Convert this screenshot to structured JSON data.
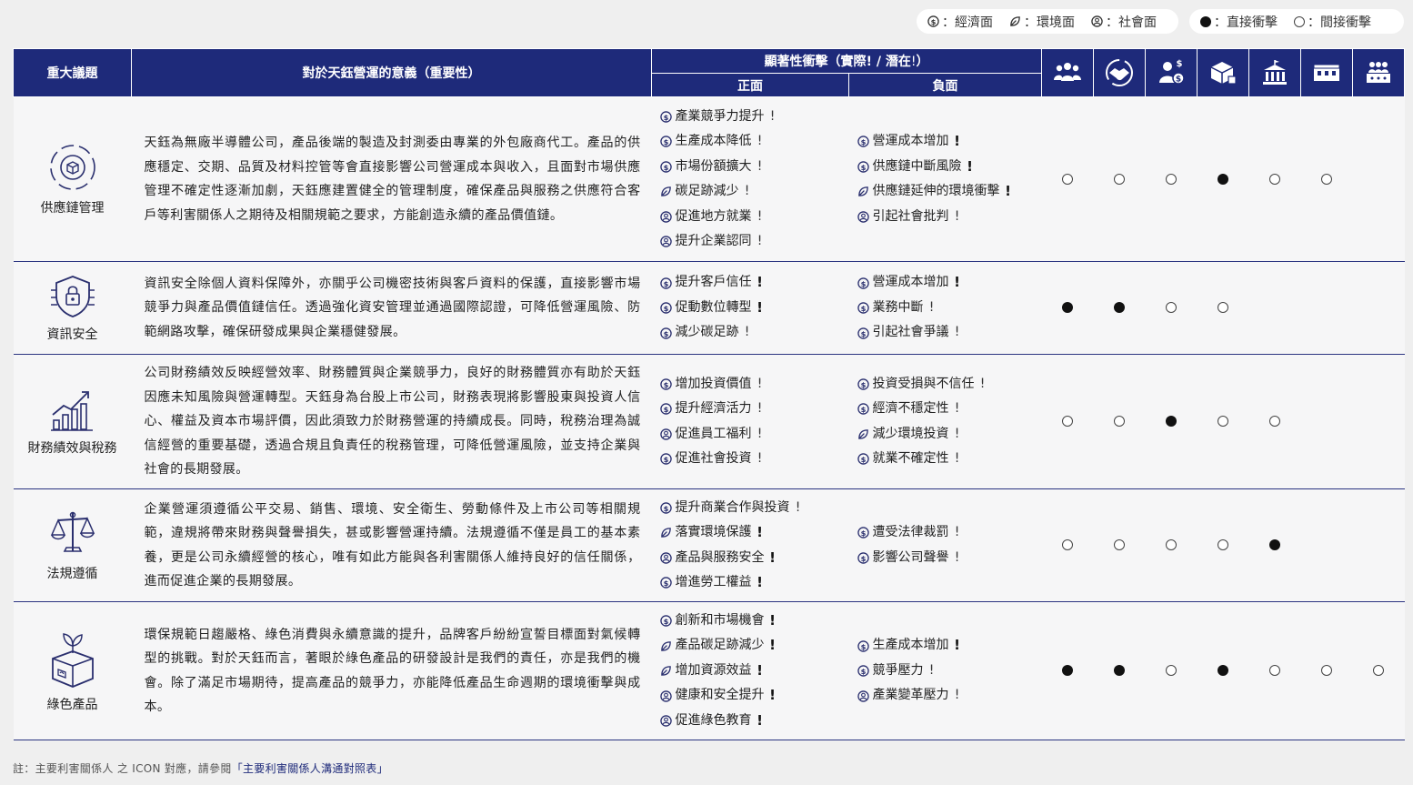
{
  "legend": {
    "dimensions": [
      {
        "icon": "economic-icon",
        "label": "：經濟面"
      },
      {
        "icon": "environment-icon",
        "label": "：環境面"
      },
      {
        "icon": "social-icon",
        "label": "：社會面"
      }
    ],
    "impacts": [
      {
        "type": "filled",
        "label": "：直接衝擊"
      },
      {
        "type": "empty",
        "label": "：間接衝擊"
      }
    ]
  },
  "header": {
    "topic": "重大議題",
    "meaning": "對於天鈺營運的意義（重要性）",
    "impact_title_pre": "顯著性衝擊（實際",
    "impact_title_mid": " / 潛在",
    "impact_title_post": "）",
    "positive": "正面",
    "negative": "負面",
    "stakeholder_icons": [
      "employees-icon",
      "customers-icon",
      "investors-icon",
      "suppliers-icon",
      "government-icon",
      "community-icon",
      "media-icon"
    ]
  },
  "rows": [
    {
      "topic": "供應鏈管理",
      "icon": "supply-chain-icon",
      "description": "天鈺為無廠半導體公司，產品後端的製造及封測委由專業的外包廠商代工。產品的供應穩定、交期、品質及材料控管等會直接影響公司營運成本與收入，且面對市場供應管理不確定性逐漸加劇，天鈺應建置健全的管理制度，確保產品與服務之供應符合客戶等利害關係人之期待及相關規範之要求，方能創造永續的產品價值鏈。",
      "positive": [
        {
          "dim": "economic",
          "text": "產業競爭力提升",
          "kind": "potential"
        },
        {
          "dim": "economic",
          "text": "生產成本降低",
          "kind": "potential"
        },
        {
          "dim": "economic",
          "text": "市場份額擴大",
          "kind": "potential"
        },
        {
          "dim": "environment",
          "text": "碳足跡減少",
          "kind": "potential"
        },
        {
          "dim": "social",
          "text": "促進地方就業",
          "kind": "potential"
        },
        {
          "dim": "social",
          "text": "提升企業認同",
          "kind": "potential"
        }
      ],
      "negative": [
        {
          "dim": "economic",
          "text": "營運成本增加",
          "kind": "actual"
        },
        {
          "dim": "economic",
          "text": "供應鏈中斷風險",
          "kind": "actual"
        },
        {
          "dim": "environment",
          "text": "供應鏈延伸的環境衝擊",
          "kind": "actual"
        },
        {
          "dim": "social",
          "text": "引起社會批判",
          "kind": "potential"
        }
      ],
      "impacts": [
        "empty",
        "empty",
        "empty",
        "filled",
        "empty",
        "empty",
        ""
      ]
    },
    {
      "topic": "資訊安全",
      "icon": "info-security-icon",
      "description": "資訊安全除個人資料保障外，亦關乎公司機密技術與客戶資料的保護，直接影響市場競爭力與產品價值鏈信任。透過強化資安管理並通過國際認證，可降低營運風險、防範網路攻擊，確保研發成果與企業穩健發展。",
      "positive": [
        {
          "dim": "economic",
          "text": "提升客戶信任",
          "kind": "actual"
        },
        {
          "dim": "economic",
          "text": "促動數位轉型",
          "kind": "actual"
        },
        {
          "dim": "economic",
          "text": "減少碳足跡",
          "kind": "potential"
        }
      ],
      "negative": [
        {
          "dim": "economic",
          "text": "營運成本增加",
          "kind": "actual"
        },
        {
          "dim": "economic",
          "text": "業務中斷",
          "kind": "potential"
        },
        {
          "dim": "economic",
          "text": "引起社會爭議",
          "kind": "potential"
        }
      ],
      "impacts": [
        "filled",
        "filled",
        "empty",
        "empty",
        "",
        "",
        ""
      ]
    },
    {
      "topic": "財務績效與稅務",
      "icon": "finance-icon",
      "description": "公司財務績效反映經營效率、財務體質與企業競爭力，良好的財務體質亦有助於天鈺因應未知風險與營運轉型。天鈺身為台股上市公司，財務表現將影響股東與投資人信心、權益及資本市場評價，因此須致力於財務營運的持續成長。同時，稅務治理為誠信經營的重要基礎，透過合規且負責任的稅務管理，可降低營運風險，並支持企業與社會的長期發展。",
      "positive": [
        {
          "dim": "economic",
          "text": "增加投資價值",
          "kind": "potential"
        },
        {
          "dim": "economic",
          "text": "提升經濟活力",
          "kind": "potential"
        },
        {
          "dim": "social",
          "text": "促進員工福利",
          "kind": "potential"
        },
        {
          "dim": "economic",
          "text": "促進社會投資",
          "kind": "potential"
        }
      ],
      "negative": [
        {
          "dim": "economic",
          "text": "投資受損與不信任",
          "kind": "potential"
        },
        {
          "dim": "economic",
          "text": "經濟不穩定性",
          "kind": "potential"
        },
        {
          "dim": "environment",
          "text": "減少環境投資",
          "kind": "potential"
        },
        {
          "dim": "economic",
          "text": "就業不確定性",
          "kind": "potential"
        }
      ],
      "impacts": [
        "empty",
        "empty",
        "filled",
        "empty",
        "empty",
        "",
        ""
      ]
    },
    {
      "topic": "法規遵循",
      "icon": "compliance-icon",
      "description": "企業營運須遵循公平交易、銷售、環境、安全衛生、勞動條件及上市公司等相關規範，違規將帶來財務與聲譽損失，甚或影響營運持續。法規遵循不僅是員工的基本素養，更是公司永續經營的核心，唯有如此方能與各利害關係人維持良好的信任關係，進而促進企業的長期發展。",
      "positive": [
        {
          "dim": "economic",
          "text": "提升商業合作與投資",
          "kind": "potential"
        },
        {
          "dim": "environment",
          "text": "落實環境保護",
          "kind": "actual"
        },
        {
          "dim": "social",
          "text": "產品與服務安全",
          "kind": "actual"
        },
        {
          "dim": "economic",
          "text": "增進勞工權益",
          "kind": "actual"
        }
      ],
      "negative": [
        {
          "dim": "economic",
          "text": "遭受法律裁罰",
          "kind": "potential"
        },
        {
          "dim": "economic",
          "text": "影響公司聲譽",
          "kind": "potential"
        }
      ],
      "impacts": [
        "empty",
        "empty",
        "empty",
        "empty",
        "filled",
        "",
        ""
      ]
    },
    {
      "topic": "綠色產品",
      "icon": "green-product-icon",
      "description": "環保規範日趨嚴格、綠色消費與永續意識的提升，品牌客戶紛紛宣誓目標面對氣候轉型的挑戰。對於天鈺而言，著眼於綠色產品的研發設計是我們的責任，亦是我們的機會。除了滿足市場期待，提高產品的競爭力，亦能降低產品生命週期的環境衝擊與成本。",
      "positive": [
        {
          "dim": "economic",
          "text": "創新和市場機會",
          "kind": "actual"
        },
        {
          "dim": "environment",
          "text": "產品碳足跡減少",
          "kind": "actual"
        },
        {
          "dim": "environment",
          "text": "增加資源效益",
          "kind": "actual"
        },
        {
          "dim": "social",
          "text": "健康和安全提升",
          "kind": "actual"
        },
        {
          "dim": "social",
          "text": "促進綠色教育",
          "kind": "actual"
        }
      ],
      "negative": [
        {
          "dim": "economic",
          "text": "生產成本增加",
          "kind": "actual"
        },
        {
          "dim": "economic",
          "text": "競爭壓力",
          "kind": "potential"
        },
        {
          "dim": "social",
          "text": "產業變革壓力",
          "kind": "potential"
        }
      ],
      "impacts": [
        "filled",
        "filled",
        "empty",
        "filled",
        "empty",
        "empty",
        "empty"
      ]
    }
  ],
  "footnote": {
    "text": "註：主要利害關係人 之 ICON 對應，請參閱",
    "link": "「主要利害關係人溝通對照表」"
  }
}
